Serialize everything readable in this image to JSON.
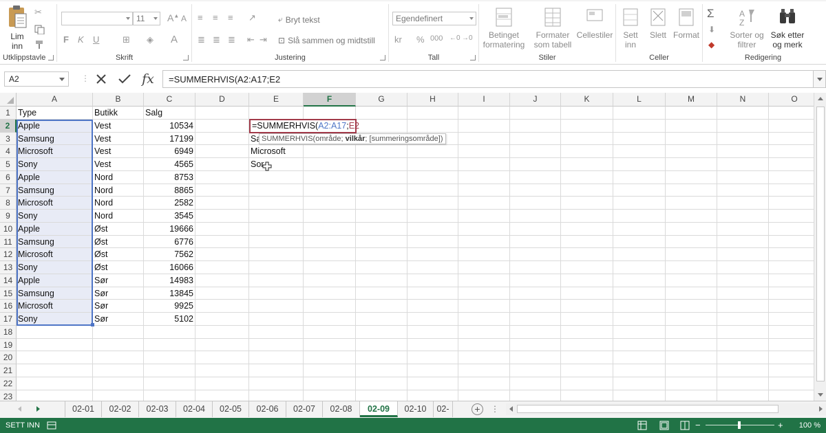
{
  "ribbon": {
    "clipboard": {
      "paste_label_1": "Lim",
      "paste_label_2": "inn",
      "group_label": "Utklippstavle"
    },
    "font": {
      "size": "11",
      "bold": "F",
      "italic": "K",
      "underline": "U",
      "group_label": "Skrift"
    },
    "alignment": {
      "wrap_text": "Bryt tekst",
      "merge_center": "Slå sammen og midtstill",
      "group_label": "Justering"
    },
    "number": {
      "format": "Egendefinert",
      "currency": "kr",
      "percent": "%",
      "thousands": "000",
      "group_label": "Tall"
    },
    "styles": {
      "conditional_1": "Betinget",
      "conditional_2": "formatering",
      "format_table_1": "Formater",
      "format_table_2": "som tabell",
      "cell_styles": "Cellestiler",
      "group_label": "Stiler"
    },
    "cells": {
      "insert_1": "Sett",
      "insert_2": "inn",
      "delete": "Slett",
      "format": "Format",
      "group_label": "Celler"
    },
    "editing": {
      "sort_1": "Sorter og",
      "sort_2": "filtrer",
      "find_1": "Søk etter",
      "find_2": "og merk",
      "group_label": "Redigering"
    }
  },
  "formula_bar": {
    "name_box": "A2",
    "formula": "=SUMMERHVIS(A2:A17;E2"
  },
  "columns": [
    "A",
    "B",
    "C",
    "D",
    "E",
    "F",
    "G",
    "H",
    "I",
    "J",
    "K",
    "L",
    "M",
    "N",
    "O"
  ],
  "rows": [
    "1",
    "2",
    "3",
    "4",
    "5",
    "6",
    "7",
    "8",
    "9",
    "10",
    "11",
    "12",
    "13",
    "14",
    "15",
    "16",
    "17",
    "18",
    "19",
    "20",
    "21",
    "22",
    "23"
  ],
  "table": {
    "headers": [
      "Type",
      "Butikk",
      "Salg"
    ],
    "data": [
      [
        "Apple",
        "Vest",
        "10534"
      ],
      [
        "Samsung",
        "Vest",
        "17199"
      ],
      [
        "Microsoft",
        "Vest",
        "6949"
      ],
      [
        "Sony",
        "Vest",
        "4565"
      ],
      [
        "Apple",
        "Nord",
        "8753"
      ],
      [
        "Samsung",
        "Nord",
        "8865"
      ],
      [
        "Microsoft",
        "Nord",
        "2582"
      ],
      [
        "Sony",
        "Nord",
        "3545"
      ],
      [
        "Apple",
        "Øst",
        "19666"
      ],
      [
        "Samsung",
        "Øst",
        "6776"
      ],
      [
        "Microsoft",
        "Øst",
        "7562"
      ],
      [
        "Sony",
        "Øst",
        "16066"
      ],
      [
        "Apple",
        "Sør",
        "14983"
      ],
      [
        "Samsung",
        "Sør",
        "13845"
      ],
      [
        "Microsoft",
        "Sør",
        "9925"
      ],
      [
        "Sony",
        "Sør",
        "5102"
      ]
    ]
  },
  "column_e": [
    "Sa",
    "Microsoft",
    "Sor"
  ],
  "editing_cell": {
    "prefix": "=SUMMERHVIS(",
    "ref1": "A2:A17",
    "sep": ";",
    "ref2": "E2"
  },
  "tooltip": {
    "fn": "SUMMERHVIS(",
    "arg1": "område; ",
    "arg2": "vilkår",
    "arg3": "; [summeringsområde])"
  },
  "sheets": [
    "02-01",
    "02-02",
    "02-03",
    "02-04",
    "02-05",
    "02-06",
    "02-07",
    "02-08",
    "02-09",
    "02-10",
    "02-"
  ],
  "active_sheet": "02-09",
  "status": {
    "mode": "SETT INN",
    "zoom": "100 %"
  },
  "colors": {
    "accent": "#217346",
    "range_blue": "#4e75c6",
    "range_red": "#a23a4a"
  }
}
